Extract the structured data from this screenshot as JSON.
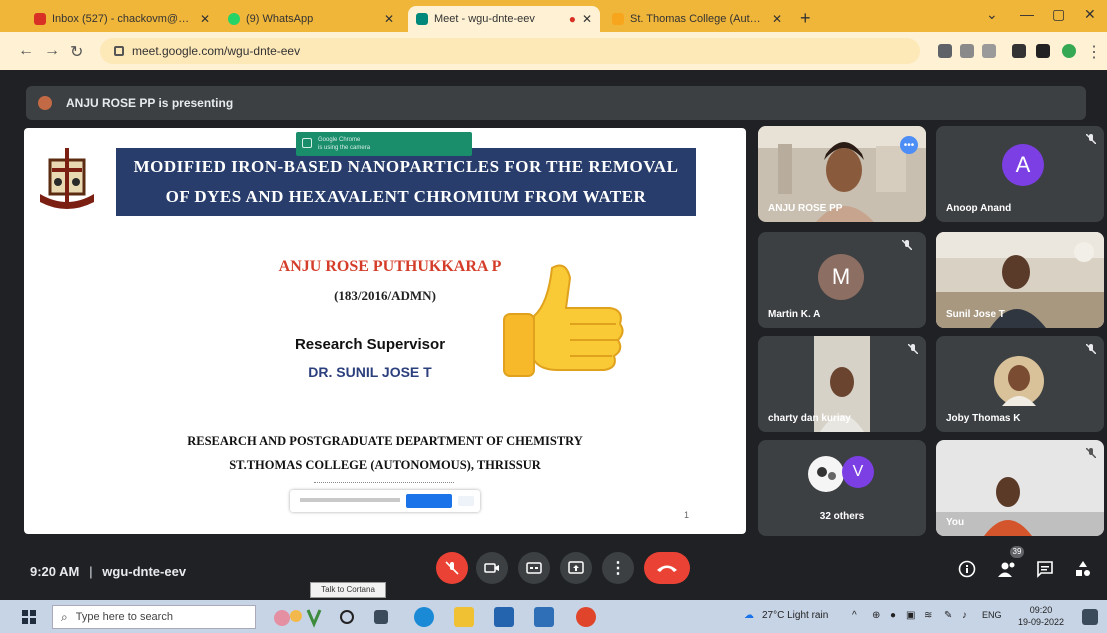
{
  "browser": {
    "tabs": [
      {
        "label": "Inbox (527) - chackovm@gmail...",
        "active": false
      },
      {
        "label": "(9) WhatsApp",
        "active": false
      },
      {
        "label": "Meet - wgu-dnte-eev",
        "active": true
      },
      {
        "label": "St. Thomas College (Autonomo...",
        "active": false
      }
    ],
    "url": "meet.google.com/wgu-dnte-eev"
  },
  "meet": {
    "presenting_text": "ANJU ROSE PP is presenting",
    "slide": {
      "chip_line1": "Google Chrome",
      "chip_line2": "is using the camera",
      "title_line1": "MODIFIED IRON-BASED NANOPARTICLES FOR THE REMOVAL",
      "title_line2": "OF DYES AND HEXAVALENT CHROMIUM FROM WATER",
      "student_name": "ANJU ROSE PUTHUKKARA P",
      "student_id": "(183/2016/ADMN)",
      "supervisor_label": "Research Supervisor",
      "supervisor_name": "DR. SUNIL JOSE T",
      "department": "RESEARCH AND POSTGRADUATE DEPARTMENT OF CHEMISTRY",
      "college": "ST.THOMAS COLLEGE (AUTONOMOUS), THRISSUR",
      "page": "1"
    },
    "participants": [
      {
        "name": "ANJU ROSE PP"
      },
      {
        "name": "Anoop Anand",
        "initial": "A",
        "color": "#7b3fe4"
      },
      {
        "name": "Martin K. A",
        "initial": "M",
        "color": "#8d6e63"
      },
      {
        "name": "Sunil Jose T"
      },
      {
        "name": "charty dan kuriay"
      },
      {
        "name": "Joby Thomas K"
      },
      {
        "name": "32 others",
        "initial": "V",
        "color": "#7b3fe4"
      },
      {
        "name": "You"
      }
    ],
    "time": "9:20 AM",
    "separator": "|",
    "meeting_code": "wgu-dnte-eev",
    "people_count": "39"
  },
  "taskbar": {
    "search_placeholder": "Type here to search",
    "tooltip": "Talk to Cortana",
    "weather": "27°C  Light rain",
    "lang": "ENG",
    "clock_time": "09:20",
    "clock_date": "19-09-2022"
  }
}
